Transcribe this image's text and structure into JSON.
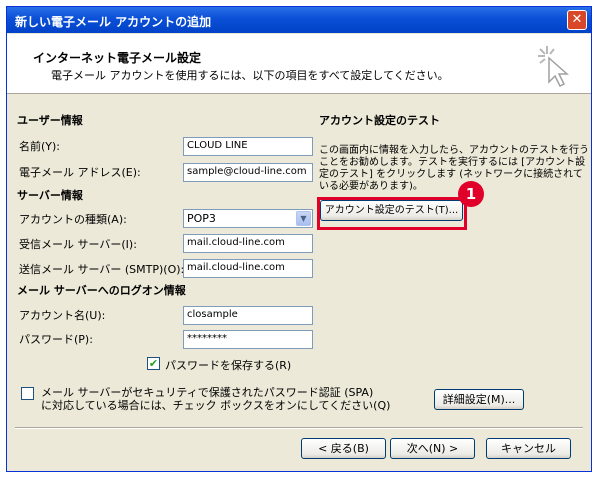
{
  "window": {
    "title": "新しい電子メール アカウントの追加",
    "close_label": "✕"
  },
  "header": {
    "title": "インターネット電子メール設定",
    "subtitle": "電子メール アカウントを使用するには、以下の項目をすべて設定してください。"
  },
  "user_info": {
    "heading": "ユーザー情報",
    "name_label": "名前(Y):",
    "name_value": "CLOUD LINE",
    "email_label": "電子メール アドレス(E):",
    "email_value": "sample@cloud-line.com"
  },
  "server_info": {
    "heading": "サーバー情報",
    "account_type_label": "アカウントの種類(A):",
    "account_type_value": "POP3",
    "incoming_label": "受信メール サーバー(I):",
    "incoming_value": "mail.cloud-line.com",
    "outgoing_label": "送信メール サーバー (SMTP)(O):",
    "outgoing_value": "mail.cloud-line.com"
  },
  "logon_info": {
    "heading": "メール サーバーへのログオン情報",
    "account_name_label": "アカウント名(U):",
    "account_name_value": "closample",
    "password_label": "パスワード(P):",
    "password_value": "********",
    "remember_label": "パスワードを保存する(R)",
    "remember_checked": true
  },
  "spa": {
    "label_line1": "メール サーバーがセキュリティで保護されたパスワード認証 (SPA)",
    "label_line2": "に対応している場合には、チェック ボックスをオンにしてください(Q)",
    "checked": false
  },
  "test": {
    "heading": "アカウント設定のテスト",
    "description": "この画面内に情報を入力したら、アカウントのテストを行うことをお勧めします。テストを実行するには [アカウント設定のテスト] をクリックします (ネットワークに接続されている必要があります)。",
    "button_label": "アカウント設定のテスト(T)...",
    "badge": "1",
    "highlight_color": "#e0002a"
  },
  "buttons": {
    "more_settings": "詳細設定(M)...",
    "back": "< 戻る(B)",
    "next": "次へ(N) >",
    "cancel": "キャンセル"
  }
}
